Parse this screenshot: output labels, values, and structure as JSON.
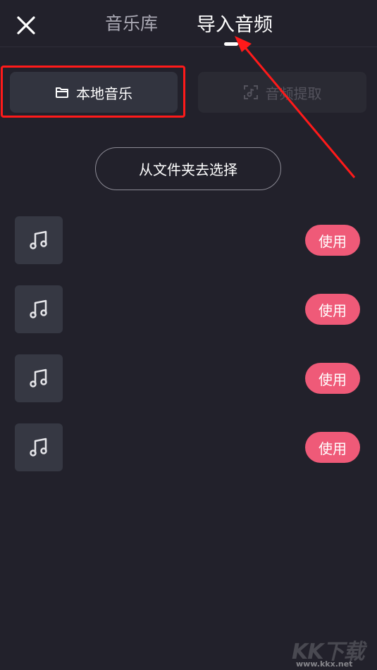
{
  "header": {
    "tabs": [
      {
        "label": "音乐库"
      },
      {
        "label": "导入音频"
      }
    ]
  },
  "sources": {
    "local_label": "本地音乐",
    "extract_label": "音频提取"
  },
  "folder_button_label": "从文件夹去选择",
  "tracks": [
    {
      "use_label": "使用"
    },
    {
      "use_label": "使用"
    },
    {
      "use_label": "使用"
    },
    {
      "use_label": "使用"
    }
  ],
  "watermark": {
    "logo": "KK下载",
    "url": "www.kkx.net"
  },
  "colors": {
    "background": "#22212b",
    "accent": "#ef5a78",
    "highlight": "#ff1a1a"
  }
}
